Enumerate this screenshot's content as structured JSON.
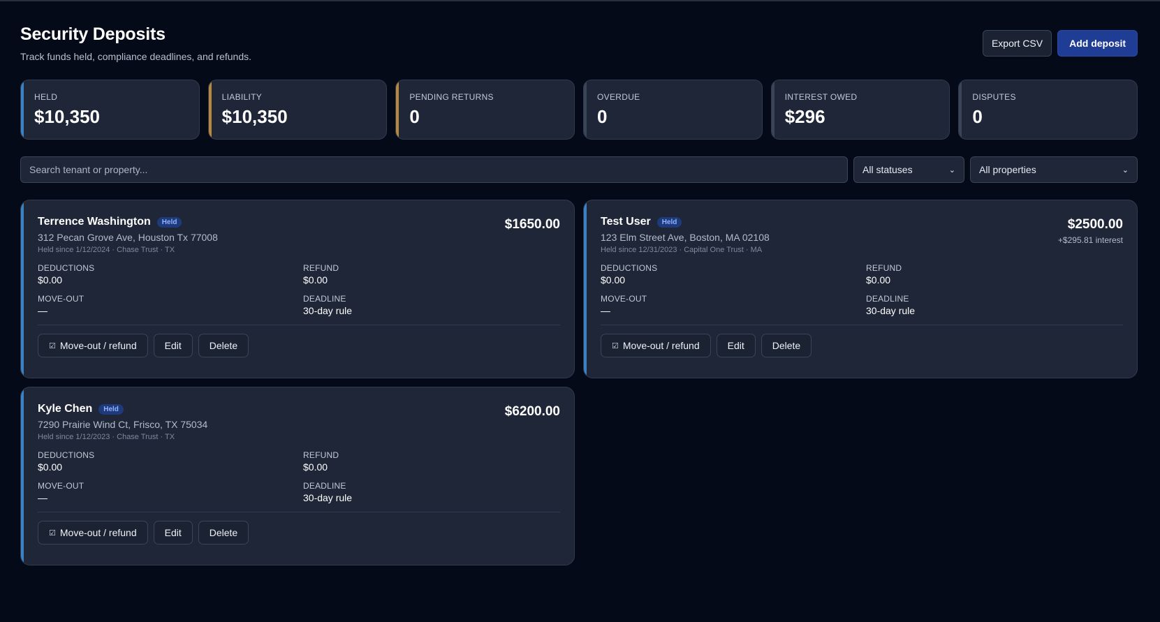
{
  "header": {
    "title": "Security Deposits",
    "subtitle": "Track funds held, compliance deadlines, and refunds.",
    "export_label": "Export CSV",
    "add_label": "Add deposit"
  },
  "stats": [
    {
      "label": "HELD",
      "value": "$10,350",
      "accent": "#3b82c4"
    },
    {
      "label": "LIABILITY",
      "value": "$10,350",
      "accent": "#b8893a"
    },
    {
      "label": "PENDING RETURNS",
      "value": "0",
      "accent": "#b8893a"
    },
    {
      "label": "OVERDUE",
      "value": "0",
      "accent": "#3a4558"
    },
    {
      "label": "INTEREST OWED",
      "value": "$296",
      "accent": "#3a4558"
    },
    {
      "label": "DISPUTES",
      "value": "0",
      "accent": "#3a4558"
    }
  ],
  "filters": {
    "search_placeholder": "Search tenant or property...",
    "status_selected": "All statuses",
    "property_selected": "All properties"
  },
  "labels": {
    "deductions": "DEDUCTIONS",
    "refund": "REFUND",
    "move_out": "MOVE-OUT",
    "deadline": "DEADLINE",
    "move_out_button": "Move-out / refund",
    "edit_button": "Edit",
    "delete_button": "Delete"
  },
  "deposits": [
    {
      "tenant": "Terrence Washington",
      "status": "Held",
      "address": "312 Pecan Grove Ave, Houston Tx 77008",
      "meta": "Held since 1/12/2024 · Chase Trust · TX",
      "amount": "$1650.00",
      "interest": "",
      "deductions": "$0.00",
      "refund": "$0.00",
      "move_out": "—",
      "deadline": "30-day rule"
    },
    {
      "tenant": "Test User",
      "status": "Held",
      "address": "123 Elm Street Ave, Boston, MA 02108",
      "meta": "Held since 12/31/2023 · Capital One Trust · MA",
      "amount": "$2500.00",
      "interest": "+$295.81 interest",
      "deductions": "$0.00",
      "refund": "$0.00",
      "move_out": "—",
      "deadline": "30-day rule"
    },
    {
      "tenant": "Kyle Chen",
      "status": "Held",
      "address": "7290 Prairie Wind Ct, Frisco, TX 75034",
      "meta": "Held since 1/12/2023 · Chase Trust · TX",
      "amount": "$6200.00",
      "interest": "",
      "deductions": "$0.00",
      "refund": "$0.00",
      "move_out": "—",
      "deadline": "30-day rule"
    }
  ]
}
